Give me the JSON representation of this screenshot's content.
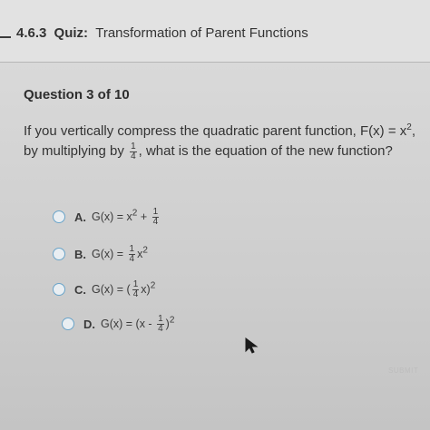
{
  "header": {
    "quiz_code": "4.6.3",
    "quiz_kind": "Quiz:",
    "quiz_name": "Transformation of Parent Functions"
  },
  "question": {
    "number_label": "Question 3 of 10",
    "text_part1": "If you vertically compress the quadratic parent function, F(x) = x",
    "text_exp": "2",
    "text_part2": ", by multiplying by ",
    "frac_num": "1",
    "frac_den": "4",
    "text_part3": ", what is the equation of the new function?"
  },
  "choices": [
    {
      "letter": "A.",
      "expr_a": "G(x) = x",
      "exp": "2",
      "expr_b": " + ",
      "frac_num": "1",
      "frac_den": "4",
      "expr_c": ""
    },
    {
      "letter": "B.",
      "expr_a": "G(x) = ",
      "frac_num": "1",
      "frac_den": "4",
      "expr_b": "x",
      "exp": "2"
    },
    {
      "letter": "C.",
      "expr_a": "G(x) = (",
      "frac_num": "1",
      "frac_den": "4",
      "expr_b": "x)",
      "exp": "2"
    },
    {
      "letter": "D.",
      "expr_a": "G(x) = (x - ",
      "frac_num": "1",
      "frac_den": "4",
      "expr_b": ")",
      "exp": "2"
    }
  ],
  "submit_label": "SUBMIT",
  "colors": {
    "radio_border": "#6aa4c9",
    "background": "#cfcfcf"
  }
}
